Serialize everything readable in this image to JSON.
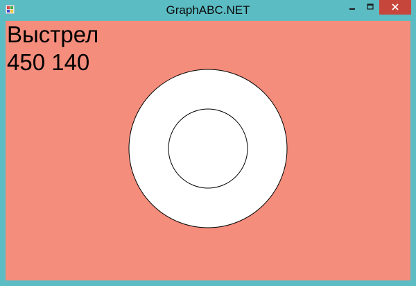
{
  "window": {
    "title": "GraphABC.NET",
    "icon": "app-icon"
  },
  "controls": {
    "minimize_icon": "minimize-icon",
    "maximize_icon": "maximize-icon",
    "close_icon": "close-icon"
  },
  "canvas": {
    "background": "#f48d7c",
    "text_line_1": "Выстрел",
    "text_line_2": "450 140",
    "target_fill": "#ffffff",
    "target_stroke": "#000000"
  }
}
